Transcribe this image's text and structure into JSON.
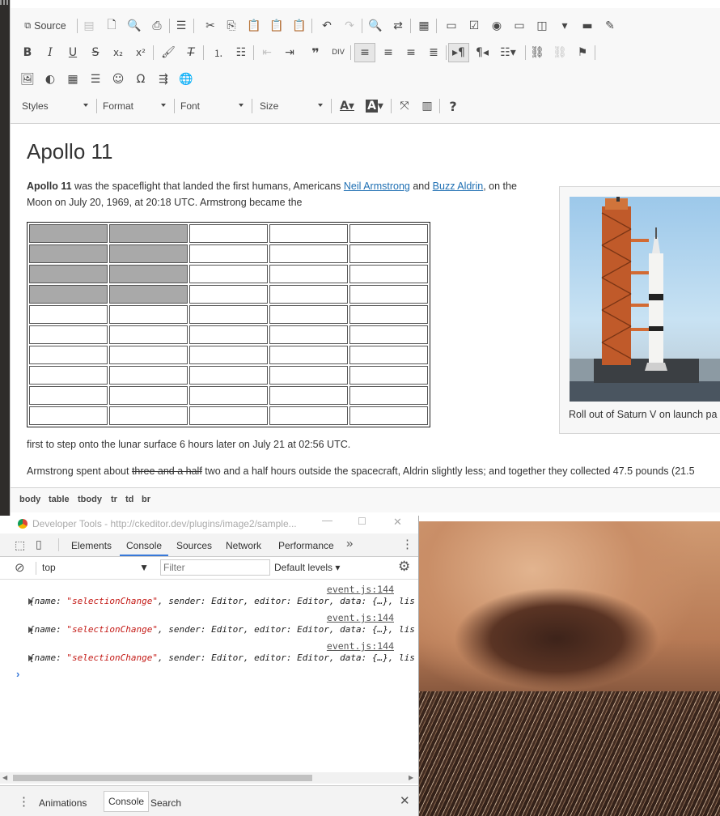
{
  "toolbar": {
    "source_label": "Source",
    "styles_label": "Styles",
    "format_label": "Format",
    "font_label": "Font",
    "size_label": "Size",
    "help_label": "?"
  },
  "document": {
    "title": "Apollo 11",
    "p1_bold": "Apollo 11",
    "p1_a": " was the spaceflight that landed the first humans, Americans ",
    "link1": "Neil Armstrong",
    "p1_b": " and ",
    "link2": "Buzz Aldrin",
    "p1_c": ", on the",
    "p1_line2": "Moon on July 20, 1969, at 20:18 UTC. Armstrong became the",
    "p2": "first to step onto the lunar surface 6 hours later on July 21 at 02:56 UTC.",
    "p3_a": "Armstrong spent about ",
    "p3_strike": "three and a half",
    "p3_b": " two and a half hours outside the spacecraft, Aldrin slightly less; and together they collected 47.5 pounds (21.5",
    "caption": "Roll out of Saturn V on launch pa",
    "table": {
      "rows": 10,
      "cols": 5,
      "selected_rows": 4,
      "selected_cols": 2
    }
  },
  "pathbar": {
    "items": [
      "body",
      "table",
      "tbody",
      "tr",
      "td",
      "br"
    ]
  },
  "devtools": {
    "title": "Developer Tools - http://ckeditor.dev/plugins/image2/sample...",
    "tabs": [
      "Elements",
      "Console",
      "Sources",
      "Network",
      "Performance"
    ],
    "active_tab": "Console",
    "context": "top",
    "filter_placeholder": "Filter",
    "levels": "Default levels",
    "logs": [
      {
        "src": "event.js:144",
        "name": "\"selectionChange\"",
        "rest": ", sender: Editor, editor: Editor, data: {…}, lis"
      },
      {
        "src": "event.js:144",
        "name": "\"selectionChange\"",
        "rest": ", sender: Editor, editor: Editor, data: {…}, lis"
      },
      {
        "src": "event.js:144",
        "name": "\"selectionChange\"",
        "rest": ", sender: Editor, editor: Editor, data: {…}, lis"
      }
    ],
    "log_prefix": "{name: ",
    "drawer_tabs": [
      "Animations",
      "Console",
      "Search"
    ],
    "drawer_active": "Console"
  },
  "colors": {
    "link": "#1e6fb3",
    "selected_cell": "#a9a9a9",
    "string": "#c41a16"
  }
}
